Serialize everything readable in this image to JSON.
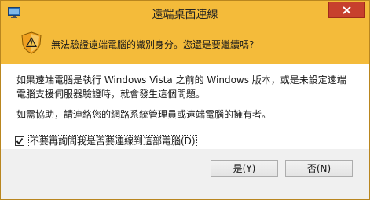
{
  "window": {
    "title": "遠端桌面連線"
  },
  "banner": {
    "message": "無法驗證遠端電腦的識別身分。您還是要繼續嗎?"
  },
  "content": {
    "paragraph1": "如果遠端電腦是執行 Windows Vista 之前的 Windows 版本，或是未設定遠端電腦支援伺服器驗證時，就會發生這個問題。",
    "paragraph2": "如需協助，請連絡您的網路系統管理員或遠端電腦的擁有者。"
  },
  "checkbox": {
    "label": "不要再詢問我是否要連線到這部電腦(D)",
    "checked": true
  },
  "buttons": {
    "yes_label": "是(Y)",
    "no_label": "否(N)"
  },
  "colors": {
    "title_bar": "#f4bb3a",
    "close_button": "#c7402d",
    "dialog_background": "#f0f0f0"
  },
  "icons": [
    "remote-desktop-icon",
    "close-icon",
    "warning-shield-icon",
    "checkmark-icon"
  ]
}
